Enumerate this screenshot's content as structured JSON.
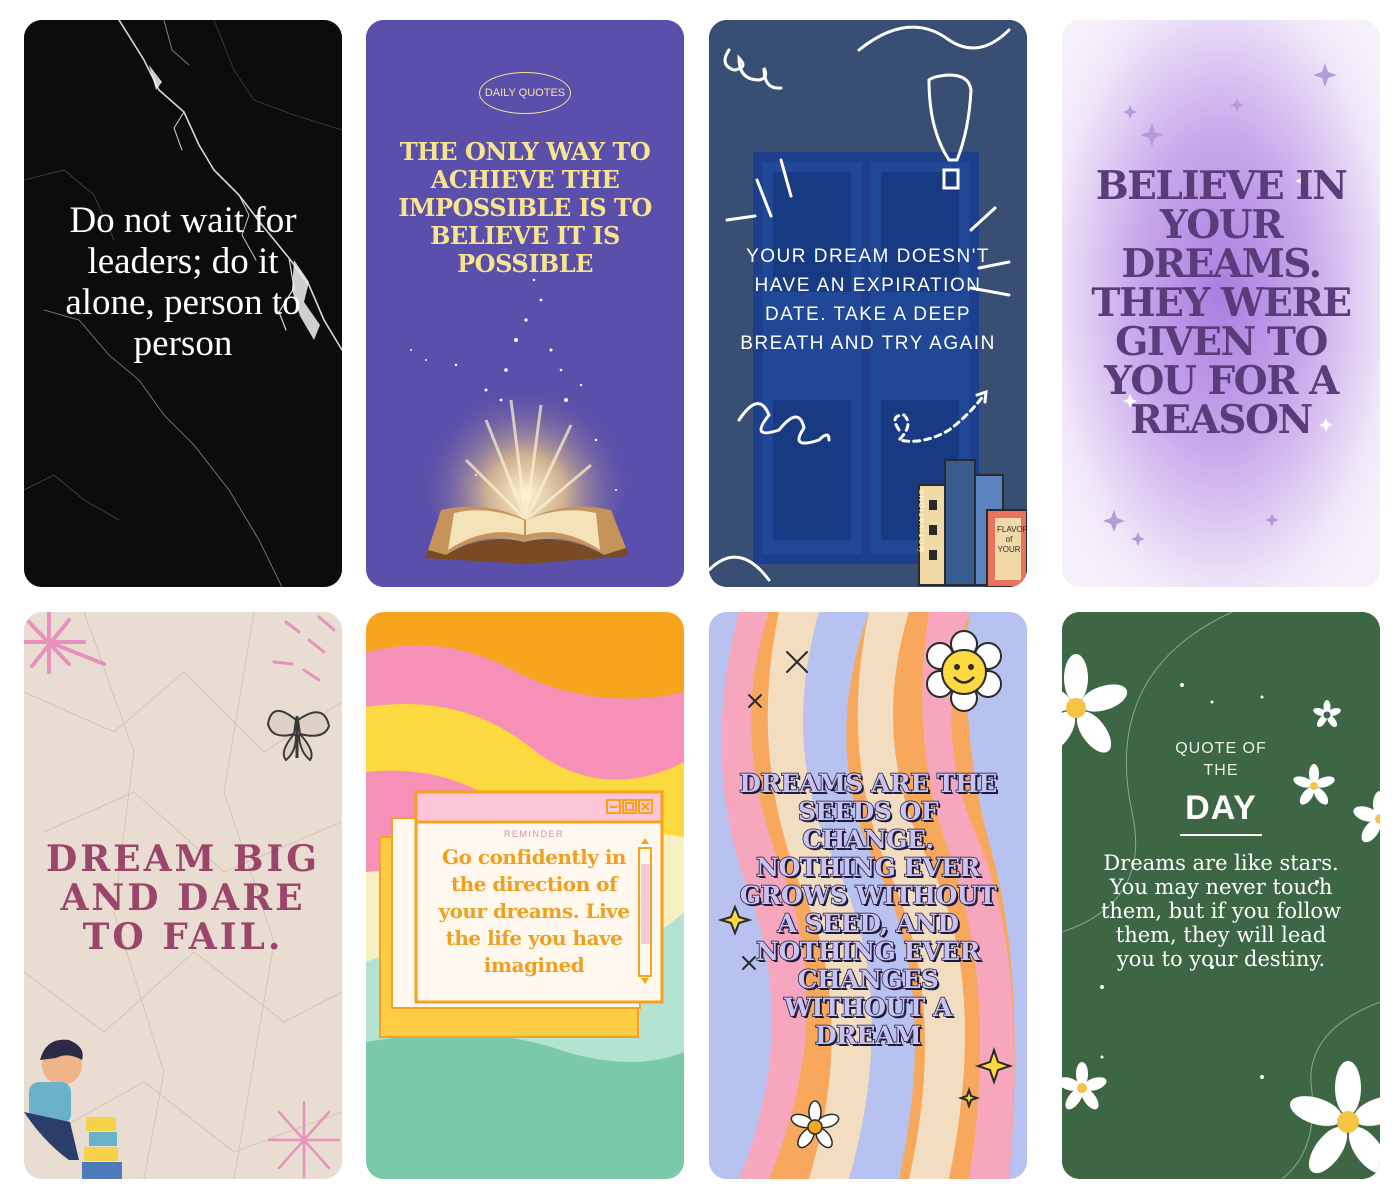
{
  "cards": [
    {
      "quote": "Do not wait for leaders; do it alone, person to person"
    },
    {
      "badge": "DAILY QUOTES",
      "quote": "THE ONLY WAY TO ACHIEVE THE IMPOSSIBLE IS TO BELIEVE IT IS POSSIBLE"
    },
    {
      "quote": "YOUR DREAM DOESN'T HAVE AN EXPIRATION DATE. TAKE A DEEP BREATH AND TRY AGAIN",
      "book_spine_1": "MOTIVATIONS",
      "book_spine_2": "FLAVOR of YOUR"
    },
    {
      "quote": "BELIEVE IN YOUR DREAMS. THEY WERE GIVEN TO YOU FOR A REASON"
    },
    {
      "quote": "DREAM BIG AND DARE TO FAIL."
    },
    {
      "window_title": "REMINDER",
      "quote": "Go confidently in the direction of your dreams. Live the life you have imagined"
    },
    {
      "quote": "DREAMS ARE THE SEEDS OF CHANGE. NOTHING EVER GROWS WITHOUT A SEED, AND NOTHING EVER CHANGES WITHOUT A DREAM"
    },
    {
      "kicker": "QUOTE OF THE",
      "headline": "DAY",
      "quote": "Dreams are like stars. You may never touch them, but if you follow them, they will lead you to your destiny."
    }
  ]
}
